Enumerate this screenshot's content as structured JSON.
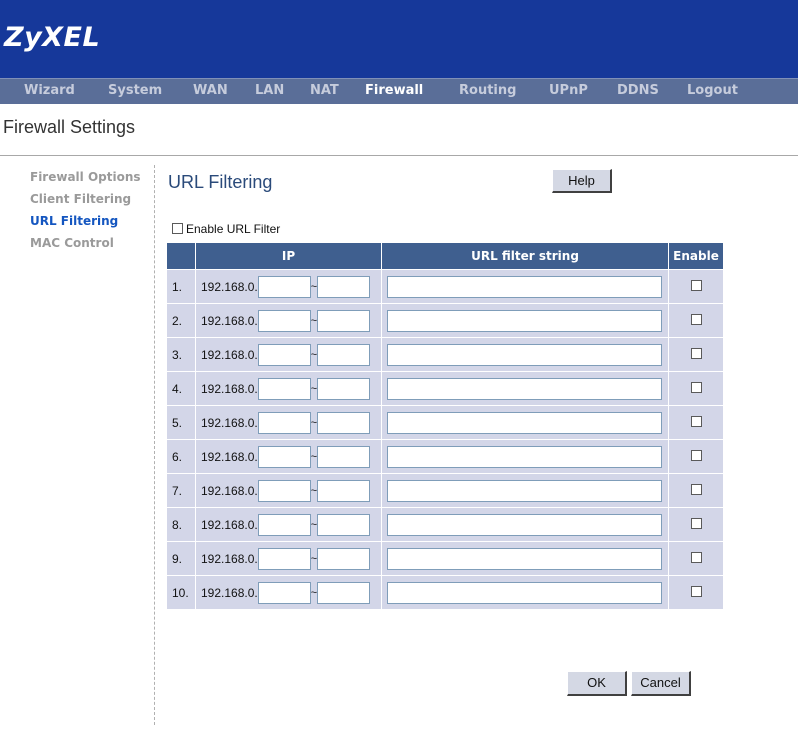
{
  "brand": {
    "logo": "ZyXEL"
  },
  "nav": {
    "items": [
      {
        "label": "Wizard"
      },
      {
        "label": "System"
      },
      {
        "label": "WAN"
      },
      {
        "label": "LAN"
      },
      {
        "label": "NAT"
      },
      {
        "label": "Firewall"
      },
      {
        "label": "Routing"
      },
      {
        "label": "UPnP"
      },
      {
        "label": "DDNS"
      },
      {
        "label": "Logout"
      }
    ],
    "active": "Firewall"
  },
  "page": {
    "title": "Firewall Settings"
  },
  "sidebar": {
    "items": [
      {
        "label": "Firewall Options"
      },
      {
        "label": "Client Filtering"
      },
      {
        "label": "URL Filtering"
      },
      {
        "label": "MAC Control"
      }
    ],
    "active": "URL Filtering"
  },
  "section": {
    "title": "URL Filtering",
    "help_label": "Help",
    "enable_filter_label": "Enable URL Filter",
    "enable_filter_checked": false
  },
  "table": {
    "headers": {
      "ip": "IP",
      "url": "URL filter string",
      "enable": "Enable"
    },
    "ip_prefix": "192.168.0.",
    "range_separator": "~",
    "rows": [
      {
        "num": "1.",
        "ip_start": "",
        "ip_end": "",
        "url": "",
        "enabled": false
      },
      {
        "num": "2.",
        "ip_start": "",
        "ip_end": "",
        "url": "",
        "enabled": false
      },
      {
        "num": "3.",
        "ip_start": "",
        "ip_end": "",
        "url": "",
        "enabled": false
      },
      {
        "num": "4.",
        "ip_start": "",
        "ip_end": "",
        "url": "",
        "enabled": false
      },
      {
        "num": "5.",
        "ip_start": "",
        "ip_end": "",
        "url": "",
        "enabled": false
      },
      {
        "num": "6.",
        "ip_start": "",
        "ip_end": "",
        "url": "",
        "enabled": false
      },
      {
        "num": "7.",
        "ip_start": "",
        "ip_end": "",
        "url": "",
        "enabled": false
      },
      {
        "num": "8.",
        "ip_start": "",
        "ip_end": "",
        "url": "",
        "enabled": false
      },
      {
        "num": "9.",
        "ip_start": "",
        "ip_end": "",
        "url": "",
        "enabled": false
      },
      {
        "num": "10.",
        "ip_start": "",
        "ip_end": "",
        "url": "",
        "enabled": false
      }
    ]
  },
  "actions": {
    "ok_label": "OK",
    "cancel_label": "Cancel"
  },
  "colors": {
    "banner": "#16389a",
    "nav_bar": "#5a6e98",
    "table_header": "#3f5f8f",
    "table_cell": "#d3d6e8",
    "active_sidebar": "#1456c0"
  }
}
